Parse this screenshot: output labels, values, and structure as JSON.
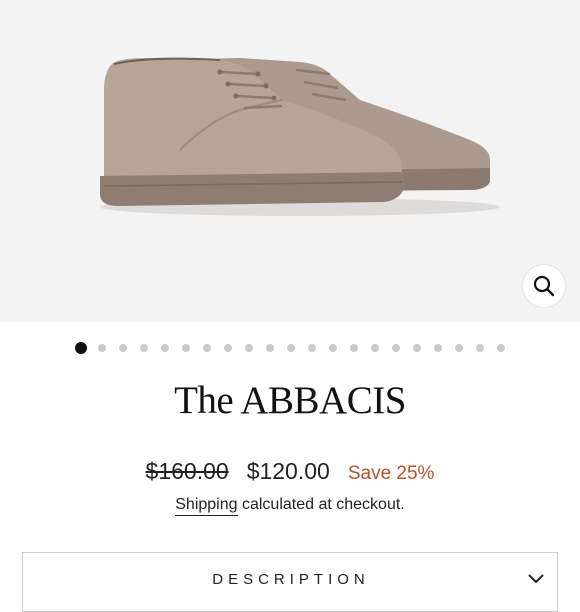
{
  "product": {
    "title": "The ABBACIS",
    "original_price": "$160.00",
    "sale_price": "$120.00",
    "savings": "Save 25%"
  },
  "gallery": {
    "image_count": 21,
    "active_index": 0,
    "zoom_icon": "search-icon"
  },
  "shipping": {
    "link_text": "Shipping",
    "text": " calculated at checkout."
  },
  "accordion": {
    "description_label": "DESCRIPTION",
    "chevron_icon": "chevron-down-icon"
  },
  "colors": {
    "hero_background": "#f3f3f3",
    "suede": "#b5a597",
    "sole": "#8e7d72",
    "savings_accent": "#b5532a",
    "active_dot": "#111111",
    "inactive_dot": "#c9c9c9"
  }
}
